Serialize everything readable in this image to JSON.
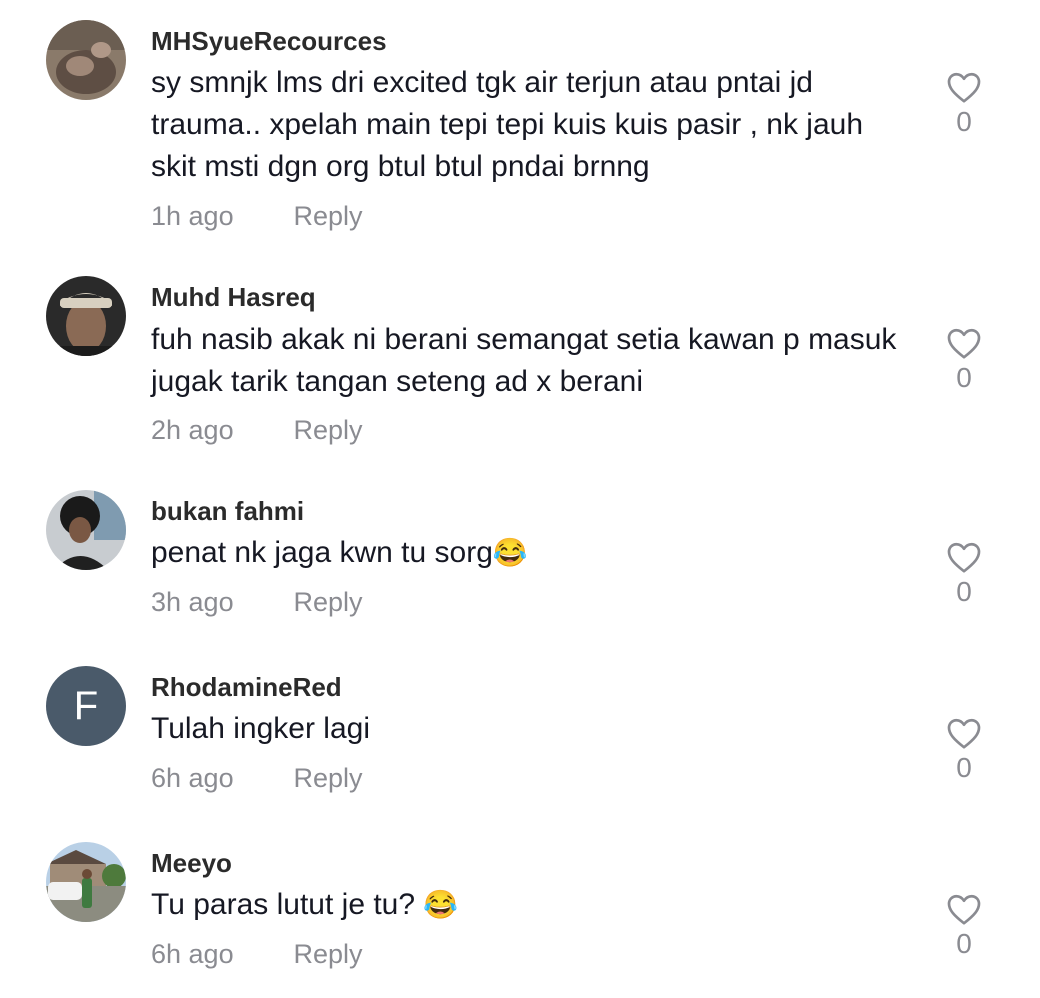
{
  "comments": [
    {
      "username": "MHSyueRecources",
      "text": "sy smnjk lms dri excited tgk air terjun atau pntai jd trauma.. xpelah main tepi tepi kuis kuis pasir , nk jauh skit msti dgn org btul btul pndai brnng",
      "time": "1h ago",
      "reply": "Reply",
      "likes": "0",
      "avatar": "photo"
    },
    {
      "username": "Muhd Hasreq",
      "text": "fuh nasib akak ni berani semangat setia kawan p masuk jugak tarik tangan seteng ad x berani",
      "time": "2h ago",
      "reply": "Reply",
      "likes": "0",
      "avatar": "photo"
    },
    {
      "username": "bukan fahmi",
      "text": "penat nk jaga kwn tu sorg",
      "emoji": "😂",
      "time": "3h ago",
      "reply": "Reply",
      "likes": "0",
      "avatar": "photo"
    },
    {
      "username": "RhodamineRed",
      "text": "Tulah ingker lagi",
      "time": "6h ago",
      "reply": "Reply",
      "likes": "0",
      "avatar_letter": "F"
    },
    {
      "username": "Meeyo",
      "text": "Tu paras lutut je tu? ",
      "emoji": "😂",
      "time": "6h ago",
      "reply": "Reply",
      "likes": "0",
      "avatar": "photo"
    }
  ],
  "colors": {
    "text": "#161823",
    "muted": "#8a8b91",
    "letter_avatar": "#4a5a6a"
  }
}
